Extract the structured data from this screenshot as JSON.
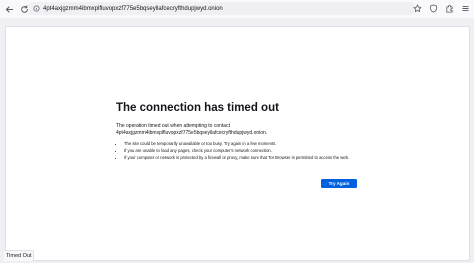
{
  "toolbar": {
    "back_icon": "back-arrow-icon",
    "reload_icon": "reload-icon",
    "url": "4pt4axjgzmm4ibmxplfluvopxzf775e5bqseyllafcecryfthdupjwyd.onion",
    "site_icon": "circle-info-icon",
    "right_icons": [
      "star-icon",
      "shield-icon",
      "extensions-icon",
      "menu-icon"
    ]
  },
  "error": {
    "title": "The connection has timed out",
    "description_line1": "The operation timed out when attempting to contact",
    "description_line2": "4pt4axjgzmm4ibmxplfluvopxzf775e5bqseyllafcecryfthdupjwyd.onion.",
    "bullets": [
      "The site could be temporarily unavailable or too busy. Try again in a few moments.",
      "If you are unable to load any pages, check your computer's network connection.",
      "If your computer or network is protected by a firewall or proxy, make sure that Tor Browser is permitted to access the web."
    ],
    "try_again_label": "Try Again"
  },
  "status_bar": {
    "text": "Timed Out"
  },
  "colors": {
    "accent": "#0061e0",
    "toolbar_bg": "#f9f9fb",
    "urlbar_bg": "#f0f0f4",
    "page_bg": "#ffffff",
    "text": "#15141a"
  }
}
